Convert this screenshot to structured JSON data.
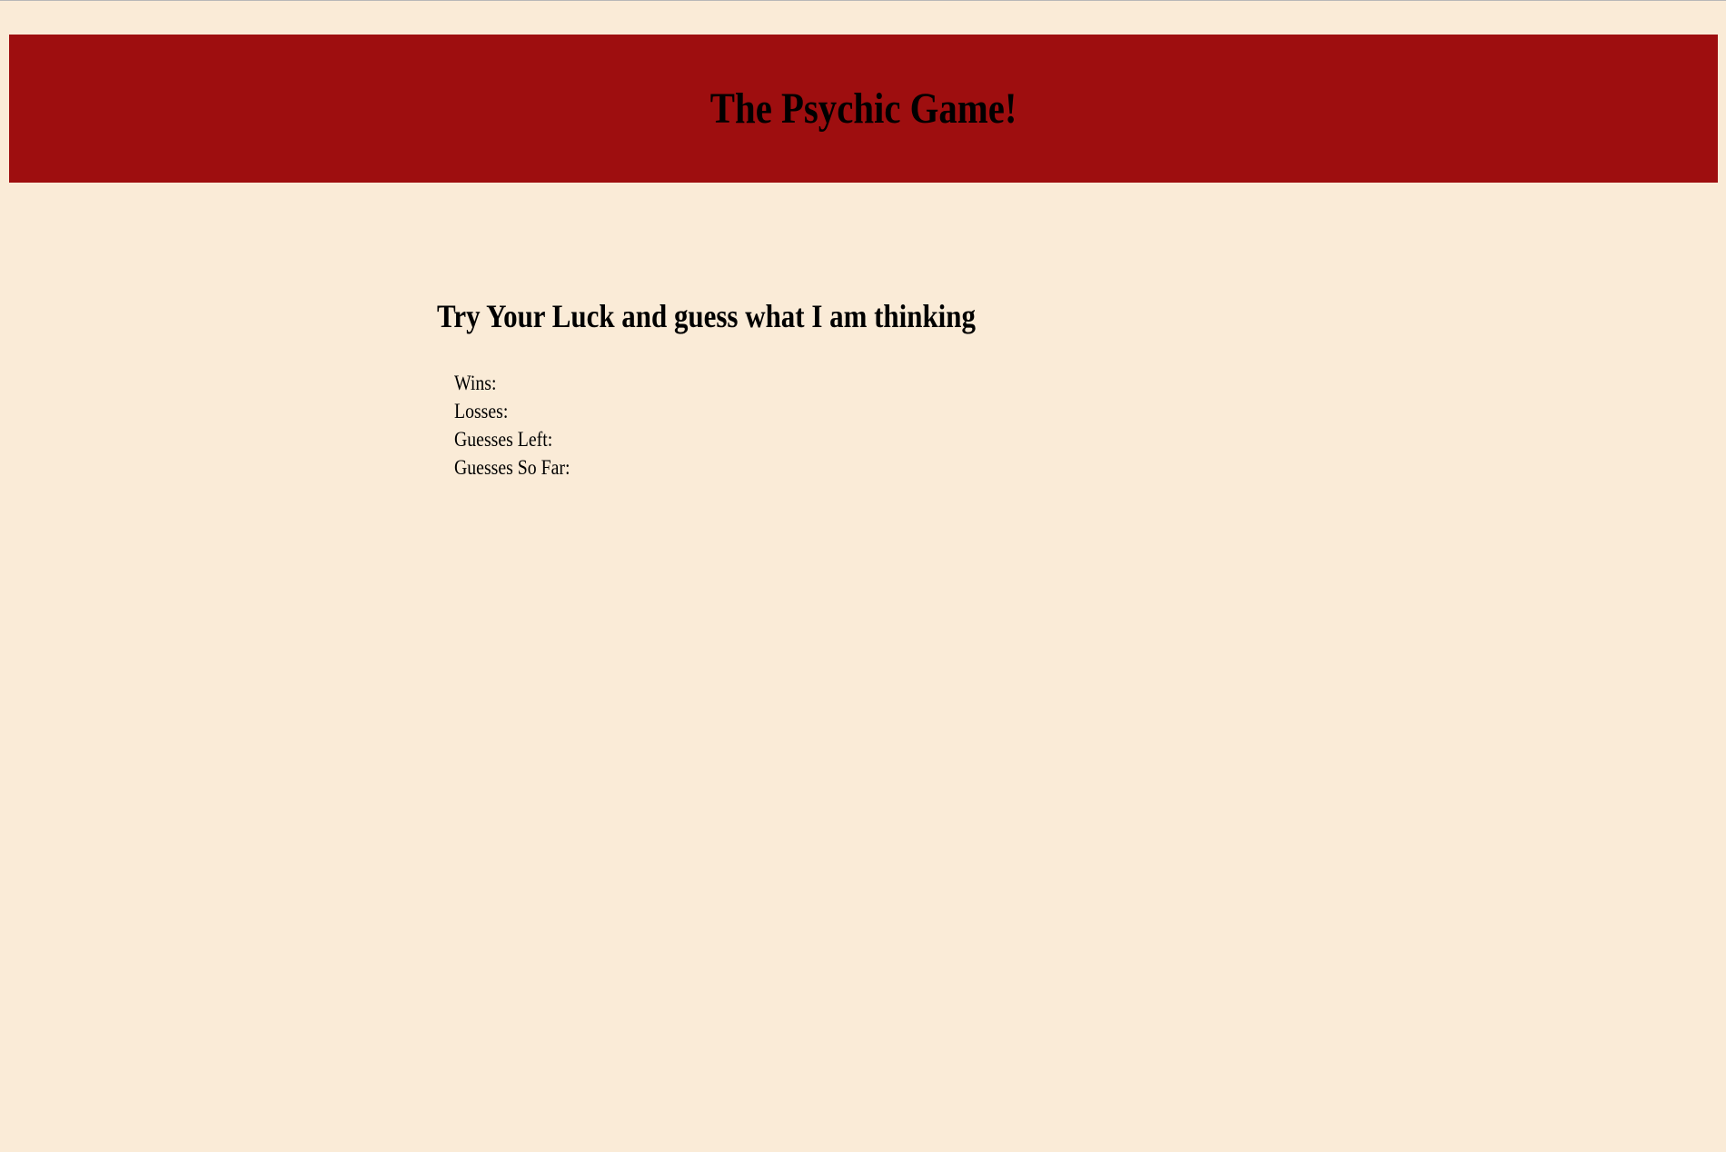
{
  "header": {
    "title": "The Psychic Game!"
  },
  "game": {
    "prompt": "Try Your Luck and guess what I am thinking",
    "stats": {
      "wins_label": "Wins:",
      "wins_value": "",
      "losses_label": "Losses:",
      "losses_value": "",
      "guesses_left_label": "Guesses Left:",
      "guesses_left_value": "",
      "guesses_so_far_label": "Guesses So Far:",
      "guesses_so_far_value": ""
    }
  },
  "colors": {
    "page_background": "#FAEBD7",
    "banner_background": "#9E0E0F",
    "text": "#000000"
  }
}
